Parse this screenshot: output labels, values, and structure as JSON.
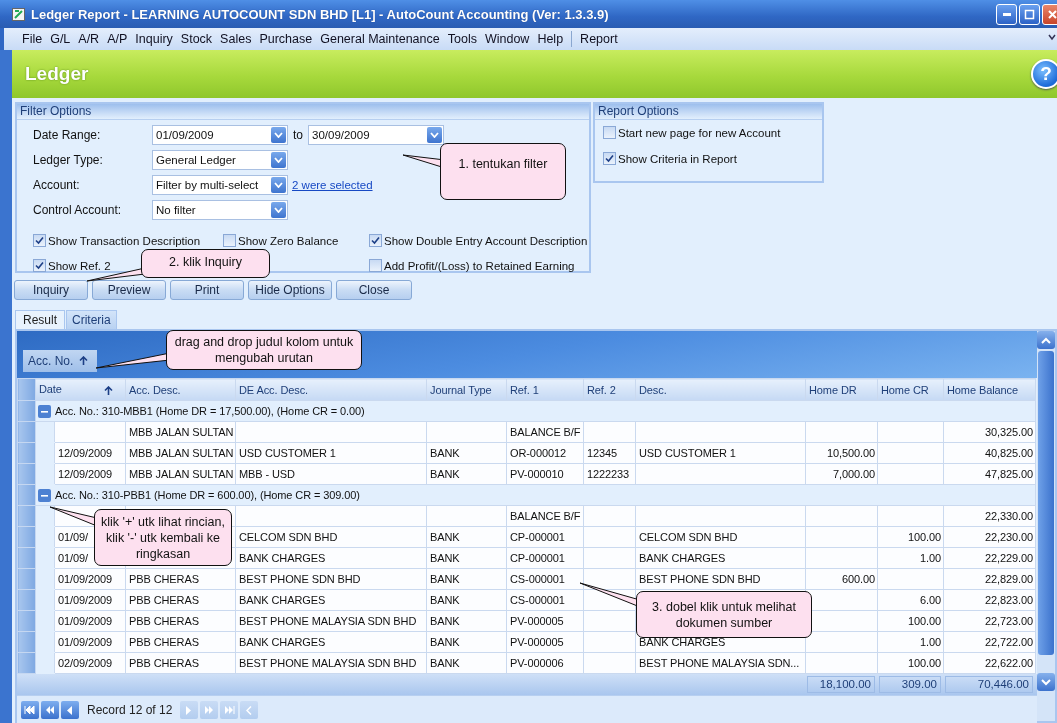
{
  "window": {
    "title": "Ledger Report - LEARNING AUTOCOUNT SDN BHD [L1] - AutoCount Accounting (Ver: 1.3.3.9)"
  },
  "menu": {
    "items": [
      "File",
      "G/L",
      "A/R",
      "A/P",
      "Inquiry",
      "Stock",
      "Sales",
      "Purchase",
      "General Maintenance",
      "Tools",
      "Window",
      "Help"
    ],
    "trailing": [
      "Report"
    ]
  },
  "header": {
    "title": "Ledger",
    "help": "?"
  },
  "filter_options": {
    "title": "Filter Options",
    "fields": [
      {
        "label": "Date Range:",
        "value": "01/09/2009",
        "to_label": "to",
        "value_2": "30/09/2009"
      },
      {
        "label": "Ledger Type:",
        "value": "General Ledger"
      },
      {
        "label": "Account:",
        "value": "Filter by multi-select",
        "link": "2 were selected"
      },
      {
        "label": "Control Account:",
        "value": "No filter"
      }
    ],
    "checkbox_rows": [
      [
        {
          "label": "Show Transaction Description",
          "checked": true
        },
        {
          "label": "Show Zero Balance",
          "checked": false
        },
        {
          "label": "Show Double Entry Account Description",
          "checked": true
        }
      ],
      [
        {
          "label": "Show Ref. 2",
          "checked": true
        },
        {
          "label": "Add Profit/(Loss) to Retained Earning",
          "checked": false
        }
      ]
    ]
  },
  "report_options": {
    "title": "Report Options",
    "checkboxes": [
      {
        "label": "Start new page for new Account",
        "checked": false
      },
      {
        "label": "Show Criteria in Report",
        "checked": true
      }
    ]
  },
  "buttons": [
    "Inquiry",
    "Preview",
    "Print",
    "Hide Options",
    "Close"
  ],
  "tabs": [
    {
      "label": "Result",
      "selected": true
    },
    {
      "label": "Criteria",
      "selected": false
    }
  ],
  "group_by": {
    "label": "Acc. No.",
    "sorted": true
  },
  "table": {
    "columns": [
      {
        "label": "Date",
        "sorted": true
      },
      {
        "label": "Acc. Desc.",
        "sorted": false
      },
      {
        "label": "DE Acc. Desc.",
        "sorted": false
      },
      {
        "label": "Journal Type",
        "sorted": false
      },
      {
        "label": "Ref. 1",
        "sorted": false
      },
      {
        "label": "Ref. 2",
        "sorted": false
      },
      {
        "label": "Desc.",
        "sorted": false
      },
      {
        "label": "Home DR",
        "sorted": false
      },
      {
        "label": "Home CR",
        "sorted": false
      },
      {
        "label": "Home Balance",
        "sorted": false
      }
    ],
    "groups": [
      {
        "label": "Acc. No.: 310-MBB1 (Home DR = 17,500.00), (Home CR = 0.00)",
        "expanded": true,
        "rows": [
          [
            null,
            "MBB JALAN SULTAN",
            null,
            null,
            "BALANCE B/F",
            null,
            null,
            null,
            null,
            "30,325.00"
          ],
          [
            "12/09/2009",
            "MBB JALAN SULTAN",
            "USD CUSTOMER 1",
            "BANK",
            "OR-000012",
            "12345",
            "USD CUSTOMER 1",
            "10,500.00",
            null,
            "40,825.00"
          ],
          [
            "12/09/2009",
            "MBB JALAN SULTAN",
            "MBB - USD",
            "BANK",
            "PV-000010",
            "1222233",
            null,
            "7,000.00",
            null,
            "47,825.00"
          ]
        ]
      },
      {
        "label": "Acc. No.: 310-PBB1 (Home DR = 600.00), (Home CR = 309.00)",
        "expanded": true,
        "rows": [
          [
            null,
            null,
            null,
            null,
            "BALANCE B/F",
            null,
            null,
            null,
            null,
            "22,330.00"
          ],
          [
            "01/09/",
            null,
            "CELCOM SDN BHD",
            "BANK",
            "CP-000001",
            null,
            "CELCOM SDN BHD",
            null,
            "100.00",
            "22,230.00"
          ],
          [
            "01/09/",
            null,
            "BANK CHARGES",
            "BANK",
            "CP-000001",
            null,
            "BANK CHARGES",
            null,
            "1.00",
            "22,229.00"
          ],
          [
            "01/09/2009",
            "PBB CHERAS",
            "BEST PHONE SDN BHD",
            "BANK",
            "CS-000001",
            null,
            "BEST PHONE SDN BHD",
            "600.00",
            null,
            "22,829.00"
          ],
          [
            "01/09/2009",
            "PBB CHERAS",
            "BANK CHARGES",
            "BANK",
            "CS-000001",
            null,
            null,
            null,
            "6.00",
            "22,823.00"
          ],
          [
            "01/09/2009",
            "PBB CHERAS",
            "BEST PHONE MALAYSIA SDN BHD",
            "BANK",
            "PV-000005",
            null,
            null,
            null,
            "100.00",
            "22,723.00"
          ],
          [
            "01/09/2009",
            "PBB CHERAS",
            "BANK CHARGES",
            "BANK",
            "PV-000005",
            null,
            "BANK CHARGES",
            null,
            "1.00",
            "22,722.00"
          ],
          [
            "02/09/2009",
            "PBB CHERAS",
            "BEST PHONE MALAYSIA SDN BHD",
            "BANK",
            "PV-000006",
            null,
            "BEST PHONE MALAYSIA SDN...",
            null,
            "100.00",
            "22,622.00"
          ]
        ]
      }
    ],
    "totals": [
      "18,100.00",
      "309.00",
      "70,446.00"
    ]
  },
  "pager": {
    "text": "Record 12 of 12",
    "buttons": [
      {
        "kind": "first",
        "disabled": false
      },
      {
        "kind": "prev_page",
        "disabled": false
      },
      {
        "kind": "prev",
        "disabled": false
      },
      {
        "kind": "next",
        "disabled": true
      },
      {
        "kind": "next_page",
        "disabled": true
      },
      {
        "kind": "last",
        "disabled": true
      },
      {
        "kind": "cancel",
        "disabled": true
      }
    ]
  },
  "callouts": [
    {
      "text": "1. tentukan filter"
    },
    {
      "text": "2. klik Inquiry"
    },
    {
      "text": "drag and drop judul kolom untuk mengubah urutan"
    },
    {
      "text": "klik '+' utk lihat rincian, klik '-' utk kembali ke ringkasan"
    },
    {
      "text": "3. dobel klik untuk melihat dokumen sumber"
    }
  ]
}
